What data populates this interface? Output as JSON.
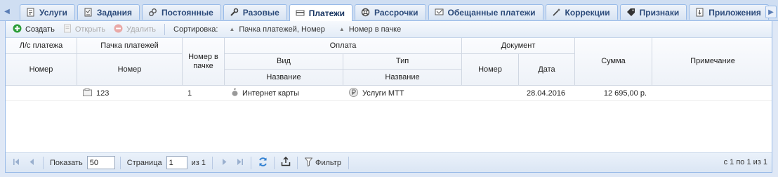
{
  "tabs": [
    {
      "label": "Услуги",
      "icon": "invoice-icon",
      "active": false
    },
    {
      "label": "Задания",
      "icon": "task-icon",
      "active": false
    },
    {
      "label": "Постоянные",
      "icon": "link-icon",
      "active": false
    },
    {
      "label": "Разовые",
      "icon": "wrench-icon",
      "active": false
    },
    {
      "label": "Платежи",
      "icon": "card-icon",
      "active": true
    },
    {
      "label": "Рассрочки",
      "icon": "lifebuoy-icon",
      "active": false
    },
    {
      "label": "Обещанные платежи",
      "icon": "promise-icon",
      "active": false
    },
    {
      "label": "Коррекции",
      "icon": "magic-wand-icon",
      "active": false
    },
    {
      "label": "Признаки",
      "icon": "tag-icon",
      "active": false
    },
    {
      "label": "Приложения",
      "icon": "attachment-icon",
      "active": false
    }
  ],
  "toolbar": {
    "create_label": "Создать",
    "open_label": "Открыть",
    "delete_label": "Удалить",
    "sort_label": "Сортировка:",
    "sort1_label": "Пачка платежей, Номер",
    "sort2_label": "Номер в пачке"
  },
  "header": {
    "ls_group": "Л/с платежа",
    "ls_number": "Номер",
    "batch_group": "Пачка платежей",
    "batch_number": "Номер",
    "in_batch": "Номер в пачке",
    "payment_group": "Оплата",
    "kind": "Вид",
    "kind_name": "Название",
    "type": "Тип",
    "type_name": "Название",
    "document_group": "Документ",
    "doc_number": "Номер",
    "doc_date": "Дата",
    "sum": "Сумма",
    "note": "Примечание"
  },
  "rows": [
    {
      "ls_number": "",
      "batch_number": "123",
      "in_batch": "1",
      "kind_name": "Интернет карты",
      "type_name": "Услуги МТТ",
      "doc_number": "",
      "doc_date": "28.04.2016",
      "sum": "12 695,00 р.",
      "note": ""
    }
  ],
  "pager": {
    "show_label": "Показать",
    "page_size": "50",
    "page_label": "Страница",
    "page": "1",
    "of_label": "из 1",
    "filter_label": "Фильтр",
    "info": "с 1 по 1 из 1"
  },
  "colors": {
    "accent": "#99bbe8",
    "create_green": "#2e9e3a",
    "delete_red": "#d9534f"
  }
}
